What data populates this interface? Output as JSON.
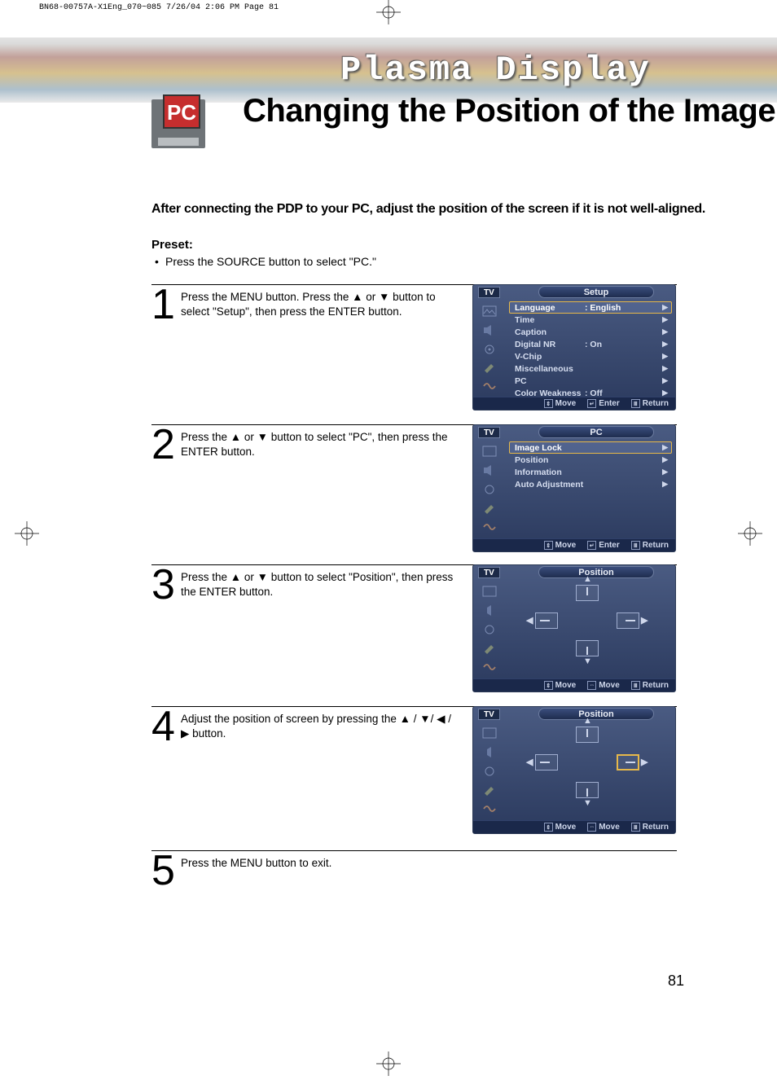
{
  "meta_header": "BN68-00757A-X1Eng_070~085  7/26/04  2:06 PM  Page 81",
  "pc_badge": "PC",
  "brand": "Plasma Display",
  "title": "Changing the Position of the Image",
  "intro": "After connecting the PDP to your PC, adjust the position of the screen if it is not well-aligned.",
  "preset_label": "Preset:",
  "preset_text": "Press the SOURCE button to select \"PC.\"",
  "steps": [
    {
      "num": "1",
      "text": "Press the MENU button. Press the ▲ or ▼ button to select \"Setup\", then press the ENTER button."
    },
    {
      "num": "2",
      "text": "Press the ▲ or ▼ button to select \"PC\", then press the ENTER button."
    },
    {
      "num": "3",
      "text": "Press the ▲ or ▼ button to select \"Position\", then press the ENTER button."
    },
    {
      "num": "4",
      "text": "Adjust the position of screen by pressing the ▲ / ▼/ ◀ / ▶ button."
    },
    {
      "num": "5",
      "text": "Press the MENU button to exit."
    }
  ],
  "osd": {
    "tv": "TV",
    "footer": {
      "move": "Move",
      "enter": "Enter",
      "return": "Return"
    },
    "menu1": {
      "title": "Setup",
      "rows": [
        {
          "label": "Language",
          "value": ":  English",
          "sel": true
        },
        {
          "label": "Time",
          "value": ""
        },
        {
          "label": "Caption",
          "value": ""
        },
        {
          "label": "Digital NR",
          "value": ":  On"
        },
        {
          "label": "V-Chip",
          "value": ""
        },
        {
          "label": "Miscellaneous",
          "value": ""
        },
        {
          "label": "PC",
          "value": ""
        },
        {
          "label": "Color Weakness",
          "value": ":  Off"
        }
      ]
    },
    "menu2": {
      "title": "PC",
      "rows": [
        {
          "label": "Image Lock",
          "value": "",
          "sel": true
        },
        {
          "label": "Position",
          "value": ""
        },
        {
          "label": "Information",
          "value": ""
        },
        {
          "label": "Auto Adjustment",
          "value": ""
        }
      ]
    },
    "menu3": {
      "title": "Position"
    },
    "menu4": {
      "title": "Position"
    }
  },
  "page_number": "81"
}
